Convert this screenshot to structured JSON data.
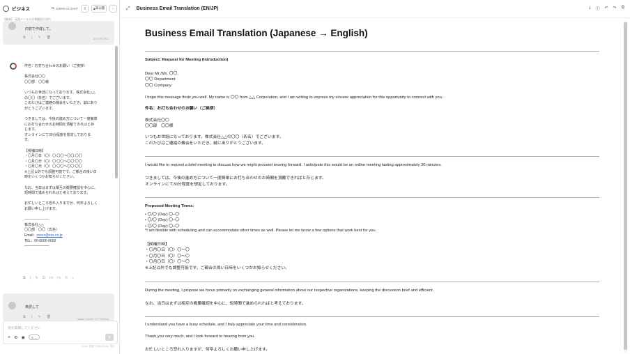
{
  "app": {
    "name": "ビジネス",
    "chip_label": "JAPAN AI CHAT",
    "share_label": "非公開",
    "more_label": "···",
    "subheader": "【業務】 英語メールの文章翻訳の流れ"
  },
  "chat": {
    "bubble1_text": "内容で作成して。",
    "bubble1_meta": "ANTHROPIC",
    "ai_lines": [
      "件名：お打ち合わせのお願い（ご挨拶）",
      "",
      "株式会社〇〇",
      "〇〇部　〇〇様",
      "",
      "いつもお世話になっております。株式会社△△",
      "の〇〇（氏名）でございます。",
      "このたびはご連絡の機会をいただき、誠にあり",
      "がとうございます。",
      "",
      "つきましては、今後の進め方について一度簡単",
      "にお打ち合わせのお時間を頂戴できればと存",
      "じます。",
      "オンラインにて30分程度を想定しておりま",
      "す。",
      "",
      "【候補日時】",
      "・〇月〇日（〇）〇:〇〇〜〇〇:〇〇",
      "・〇月〇日（〇）〇:〇〇〜〇〇:〇〇",
      "・〇月〇日（〇）〇:〇〇〜〇〇:〇〇",
      "※上記以外でも調整可能です。ご都合の良い日",
      "時をいくつかお知らせください。",
      "",
      "なお、当日はまずは相互の概要確認を中心に、",
      "短時間で進められればと考えております。",
      "",
      "お忙しいところ恐れ入りますが、何卒よろしく",
      "お願い申し上げます。",
      "",
      "──────────",
      "株式会社△△",
      "〇〇部　〇〇（氏名）",
      "Email：",
      "TEL：00-0000-0000",
      "──────────"
    ],
    "email_link": "xxxxx@xxx.co.jp",
    "bubble2_text": "英訳して",
    "bubble2_meta": "Claude Sonnet 4.5 Thinking",
    "input_placeholder": "何か質問してください",
    "model_pill": "⊘ —",
    "footnote": "Enter: 送信 / Shift+Enter: 改行"
  },
  "document": {
    "header_title": "Business Email Translation (EN/JP)",
    "title": "Business Email Translation (Japanese → English)",
    "subject": "Subject: Request for Meeting (Introduction)",
    "greeting": [
      "Dear Mr./Ms. 〇〇,",
      "〇〇 Department",
      "〇〇 Company"
    ],
    "intro_en": "I hope this message finds you well. My name is 〇〇 from △△ Corporation, and I am writing to express my sincere appreciation for this opportunity to connect with you.",
    "jp_subject": "件名：お打ち合わせのお願い（ご挨拶）",
    "jp_greeting": [
      "株式会社〇〇",
      "〇〇部　〇〇様"
    ],
    "jp_intro": [
      "いつもお世話になっております。株式会社△△の〇〇（氏名）でございます。",
      "このたびはご連絡の機会をいただき、誠にありがとうございます。"
    ],
    "request_en": "I would like to request a brief meeting to discuss how we might proceed moving forward. I anticipate this would be an online meeting lasting approximately 30 minutes.",
    "request_jp": [
      "つきましては、今後の進め方について一度簡単にお打ち合わせのお時間を頂戴できればと存じます。",
      "オンラインにて30分程度を想定しております。"
    ],
    "times_heading": "Proposed Meeting Times:",
    "times_en": [
      "• 〇/〇 (Day) 〇–〇",
      "• 〇/〇 (Day) 〇–〇",
      "• 〇/〇 (Day) 〇–〇"
    ],
    "flex_en": "*I am flexible with scheduling and can accommodate other times as well. Please let me know a few options that work best for you.",
    "times_jp_heading": "【候補日時】",
    "times_jp": [
      "・〇月〇日（〇）〇〜〇",
      "・〇月〇日（〇）〇〜〇",
      "・〇月〇日（〇）〇〜〇"
    ],
    "flex_jp": "※上記以外でも調整可能です。ご都合の良い日時をいくつかお知らせください。",
    "focus_en": "During the meeting, I propose we focus primarily on exchanging general information about our respective organizations, keeping the discussion brief and efficient.",
    "focus_jp": "なお、当日はまずは相互の概要確認を中心に、短時間で進められればと考えております。",
    "closing_en1": "I understand you have a busy schedule, and I truly appreciate your time and consideration.",
    "closing_en2": "Thank you very much, and I look forward to hearing from you.",
    "closing_jp": "お忙しいところ恐れ入りますが、何卒よろしくお願い申し上げます。"
  }
}
